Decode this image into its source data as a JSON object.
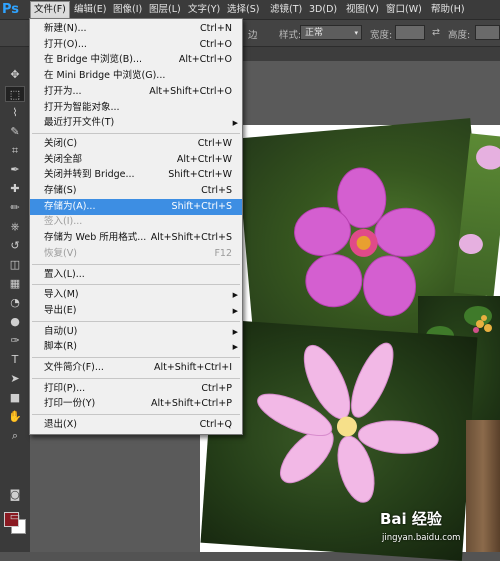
{
  "app": {
    "logo": "Ps"
  },
  "menubar": [
    {
      "label": "文件(F)",
      "active": true
    },
    {
      "label": "编辑(E)"
    },
    {
      "label": "图像(I)"
    },
    {
      "label": "图层(L)"
    },
    {
      "label": "文字(Y)"
    },
    {
      "label": "选择(S)"
    },
    {
      "label": "滤镜(T)"
    },
    {
      "label": "3D(D)"
    },
    {
      "label": "视图(V)"
    },
    {
      "label": "窗口(W)"
    },
    {
      "label": "帮助(H)"
    }
  ],
  "options": {
    "suffix_text": "边",
    "style_label": "样式:",
    "style_value": "正常",
    "width_label": "宽度:",
    "height_label": "高度:"
  },
  "file_menu": [
    {
      "label": "新建(N)...",
      "shortcut": "Ctrl+N"
    },
    {
      "label": "打开(O)...",
      "shortcut": "Ctrl+O"
    },
    {
      "label": "在 Bridge 中浏览(B)...",
      "shortcut": "Alt+Ctrl+O"
    },
    {
      "label": "在 Mini Bridge 中浏览(G)...",
      "shortcut": ""
    },
    {
      "label": "打开为...",
      "shortcut": "Alt+Shift+Ctrl+O"
    },
    {
      "label": "打开为智能对象...",
      "shortcut": ""
    },
    {
      "label": "最近打开文件(T)",
      "shortcut": "",
      "submenu": true
    },
    {
      "sep": true
    },
    {
      "label": "关闭(C)",
      "shortcut": "Ctrl+W"
    },
    {
      "label": "关闭全部",
      "shortcut": "Alt+Ctrl+W"
    },
    {
      "label": "关闭并转到 Bridge...",
      "shortcut": "Shift+Ctrl+W"
    },
    {
      "label": "存储(S)",
      "shortcut": "Ctrl+S"
    },
    {
      "label": "存储为(A)...",
      "shortcut": "Shift+Ctrl+S",
      "highlighted": true
    },
    {
      "label": "签入(I)...",
      "shortcut": "",
      "disabled": true
    },
    {
      "label": "存储为 Web 所用格式...",
      "shortcut": "Alt+Shift+Ctrl+S"
    },
    {
      "label": "恢复(V)",
      "shortcut": "F12",
      "disabled": true
    },
    {
      "sep": true
    },
    {
      "label": "置入(L)...",
      "shortcut": ""
    },
    {
      "sep": true
    },
    {
      "label": "导入(M)",
      "shortcut": "",
      "submenu": true
    },
    {
      "label": "导出(E)",
      "shortcut": "",
      "submenu": true
    },
    {
      "sep": true
    },
    {
      "label": "自动(U)",
      "shortcut": "",
      "submenu": true
    },
    {
      "label": "脚本(R)",
      "shortcut": "",
      "submenu": true
    },
    {
      "sep": true
    },
    {
      "label": "文件简介(F)...",
      "shortcut": "Alt+Shift+Ctrl+I"
    },
    {
      "sep": true
    },
    {
      "label": "打印(P)...",
      "shortcut": "Ctrl+P"
    },
    {
      "label": "打印一份(Y)",
      "shortcut": "Alt+Shift+Ctrl+P"
    },
    {
      "sep": true
    },
    {
      "label": "退出(X)",
      "shortcut": "Ctrl+Q"
    }
  ],
  "toolbar": [
    "move-icon",
    "marquee-icon",
    "lasso-icon",
    "quick-select-icon",
    "crop-icon",
    "eyedropper-icon",
    "healing-icon",
    "brush-icon",
    "stamp-icon",
    "history-brush-icon",
    "eraser-icon",
    "gradient-icon",
    "blur-icon",
    "dodge-icon",
    "pen-icon",
    "type-icon",
    "path-select-icon",
    "shape-icon",
    "hand-icon",
    "zoom-icon"
  ],
  "status": {
    "side_number": "2"
  },
  "watermark": {
    "logo": "Bai 经验",
    "url": "jingyan.baidu.com"
  },
  "colors": {
    "highlight": "#3d8ee3",
    "ps_blue": "#2fa3ff",
    "foreground": "#8a1a22",
    "background": "#ffffff"
  }
}
